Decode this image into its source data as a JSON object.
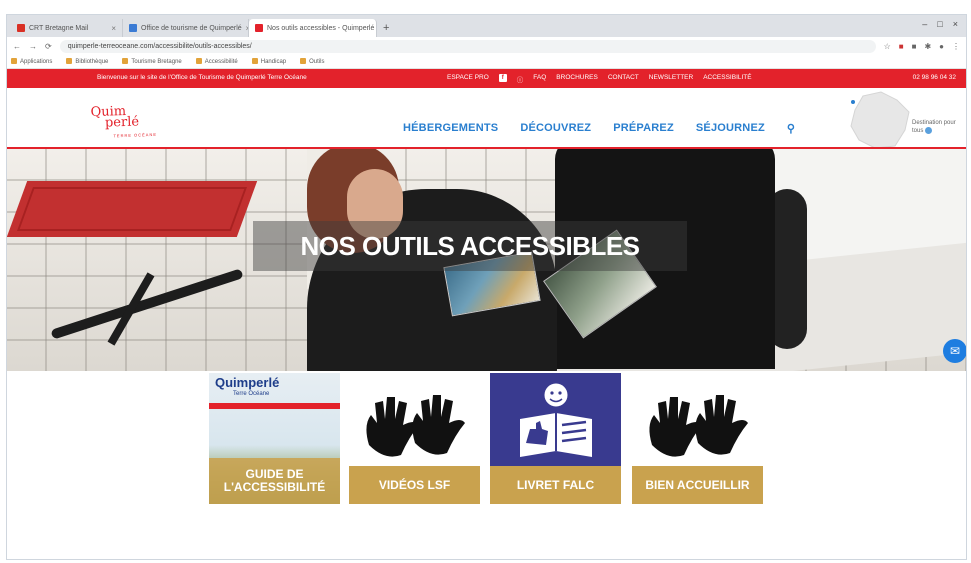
{
  "browser": {
    "tabs": [
      {
        "title": "CRT Bretagne Mail",
        "active": false,
        "color": "#d93025"
      },
      {
        "title": "Office de tourisme de Quimperlé",
        "active": false,
        "color": "#3b7bd4"
      },
      {
        "title": "Nos outils accessibles - Quimperlé",
        "active": true,
        "color": "#e3222b"
      }
    ],
    "new_tab": "+",
    "window_controls": [
      "–",
      "□",
      "×"
    ],
    "url": "quimperle-terreoceane.com/accessibilite/outils-accessibles/",
    "bookmarks": [
      "Applications",
      "Bibliothèque",
      "Tourisme Bretagne",
      "Accessibilité",
      "Handicap",
      "Outils"
    ]
  },
  "site": {
    "topbar": {
      "welcome": "Bienvenue sur le site de l'Office de Tourisme de Quimperlé Terre Océane",
      "links": [
        "ESPACE PRO",
        "f",
        "ⓘ",
        "FAQ",
        "BROCHURES",
        "CONTACT",
        "NEWSLETTER",
        "ACCESSIBILITÉ"
      ],
      "phone": "02 98 96 04 32"
    },
    "logo": {
      "line1": "Quim",
      "line2": "perlé",
      "tagline": "TERRE OCÉANE"
    },
    "nav": [
      "HÉBERGEMENTS",
      "DÉCOUVREZ",
      "PRÉPAREZ",
      "SÉJOURNEZ"
    ],
    "partner": "Destination pour tous"
  },
  "hero": {
    "title": "NOS OUTILS ACCESSIBLES"
  },
  "cards": [
    {
      "label": "GUIDE DE L'ACCESSIBILITÉ",
      "cover_title": "Quimperlé",
      "cover_sub": "Terre Océane"
    },
    {
      "label": "VIDÉOS LSF"
    },
    {
      "label": "LIVRET FALC"
    },
    {
      "label": "BIEN ACCUEILLIR"
    }
  ],
  "colors": {
    "brand_red": "#e3222b",
    "nav_blue": "#2a7fcf",
    "card_gold": "#c9a24e",
    "falc_blue": "#393a8f"
  }
}
